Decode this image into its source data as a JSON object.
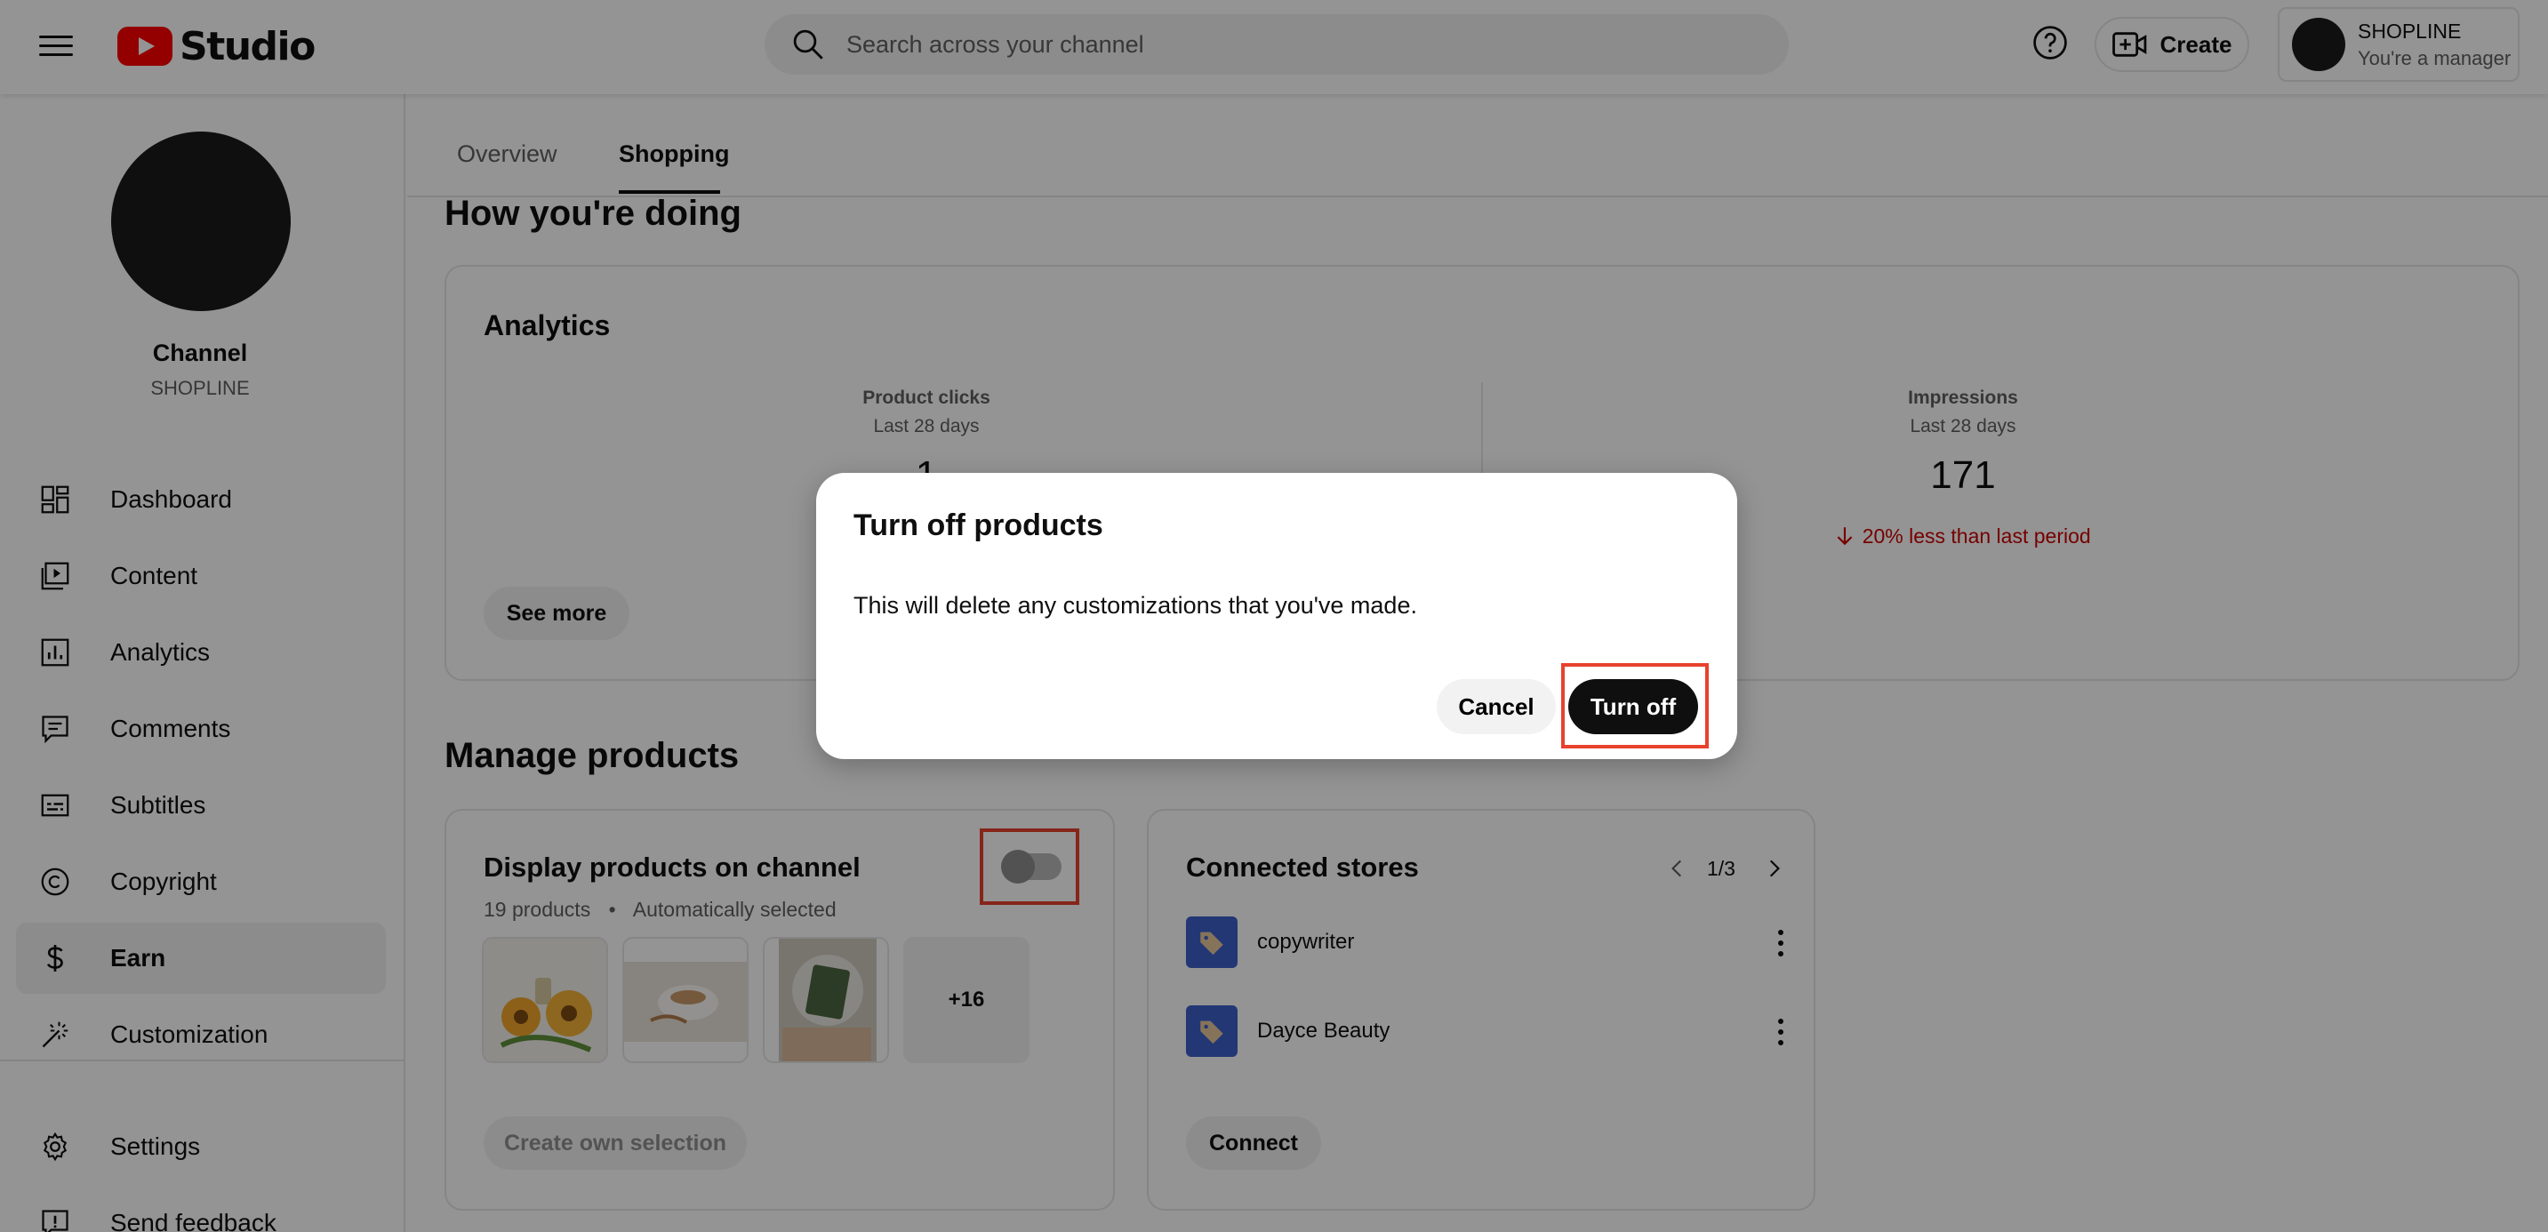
{
  "header": {
    "logo_text": "Studio",
    "search_placeholder": "Search across your channel",
    "create_label": "Create",
    "account_name": "SHOPLINE",
    "account_role": "You're a manager"
  },
  "sidebar": {
    "channel_title": "Channel",
    "channel_name": "SHOPLINE",
    "items": [
      {
        "label": "Dashboard",
        "icon": "dashboard-icon"
      },
      {
        "label": "Content",
        "icon": "content-icon"
      },
      {
        "label": "Analytics",
        "icon": "analytics-icon"
      },
      {
        "label": "Comments",
        "icon": "comments-icon"
      },
      {
        "label": "Subtitles",
        "icon": "subtitles-icon"
      },
      {
        "label": "Copyright",
        "icon": "copyright-icon"
      },
      {
        "label": "Earn",
        "icon": "dollar-icon",
        "active": true
      },
      {
        "label": "Customization",
        "icon": "magic-wand-icon"
      }
    ],
    "bottom_items": [
      {
        "label": "Settings",
        "icon": "gear-icon"
      },
      {
        "label": "Send feedback",
        "icon": "feedback-icon"
      }
    ]
  },
  "tabs": [
    {
      "label": "Overview",
      "active": false
    },
    {
      "label": "Shopping",
      "active": true
    }
  ],
  "how_doing": {
    "heading": "How you're doing",
    "analytics_title": "Analytics",
    "product_clicks_label": "Product clicks",
    "product_clicks_period": "Last 28 days",
    "product_clicks_value": "1",
    "impressions_label": "Impressions",
    "impressions_period": "Last 28 days",
    "impressions_value": "171",
    "impressions_change": "20% less than last period",
    "see_more_label": "See more"
  },
  "manage": {
    "heading": "Manage products",
    "display_title": "Display products on channel",
    "product_count": "19 products",
    "selection_mode": "Automatically selected",
    "toggle_on": false,
    "more_count": "+16",
    "create_selection_label": "Create own selection",
    "stores_title": "Connected stores",
    "stores_page": "1/3",
    "stores": [
      "copywriter",
      "Dayce Beauty"
    ],
    "connect_label": "Connect"
  },
  "dialog": {
    "title": "Turn off products",
    "body": "This will delete any customizations that you've made.",
    "cancel_label": "Cancel",
    "confirm_label": "Turn off"
  },
  "colors": {
    "brand_red": "#ff0000",
    "negative_change": "#cc0000",
    "store_icon_blue": "#3b5fc9",
    "highlight": "#e8412d"
  }
}
